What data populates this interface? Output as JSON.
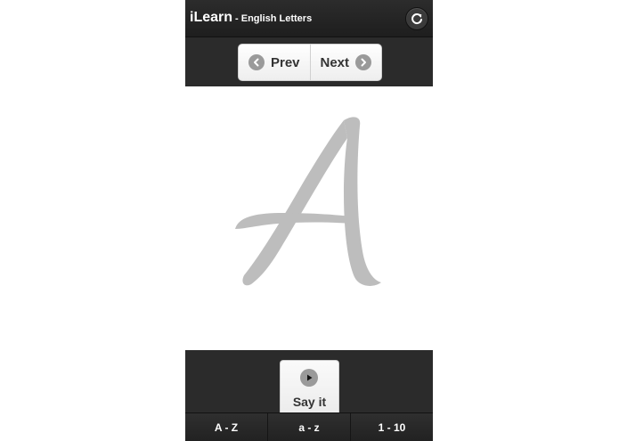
{
  "header": {
    "title": "iLearn",
    "subtitle": "- English Letters",
    "refresh_icon": "refresh-icon"
  },
  "nav": {
    "prev_label": "Prev",
    "next_label": "Next",
    "prev_icon": "chevron-left-icon",
    "next_icon": "chevron-right-icon"
  },
  "display": {
    "letter": "A",
    "letter_color": "#bdbdbd"
  },
  "audio": {
    "say_label": "Say it",
    "play_icon": "play-icon"
  },
  "tabs": [
    {
      "label": "A - Z"
    },
    {
      "label": "a - z"
    },
    {
      "label": "1 - 10"
    }
  ],
  "colors": {
    "bar": "#2b2b2b",
    "header": "#1e1e1e",
    "button": "#f4f4f4"
  }
}
